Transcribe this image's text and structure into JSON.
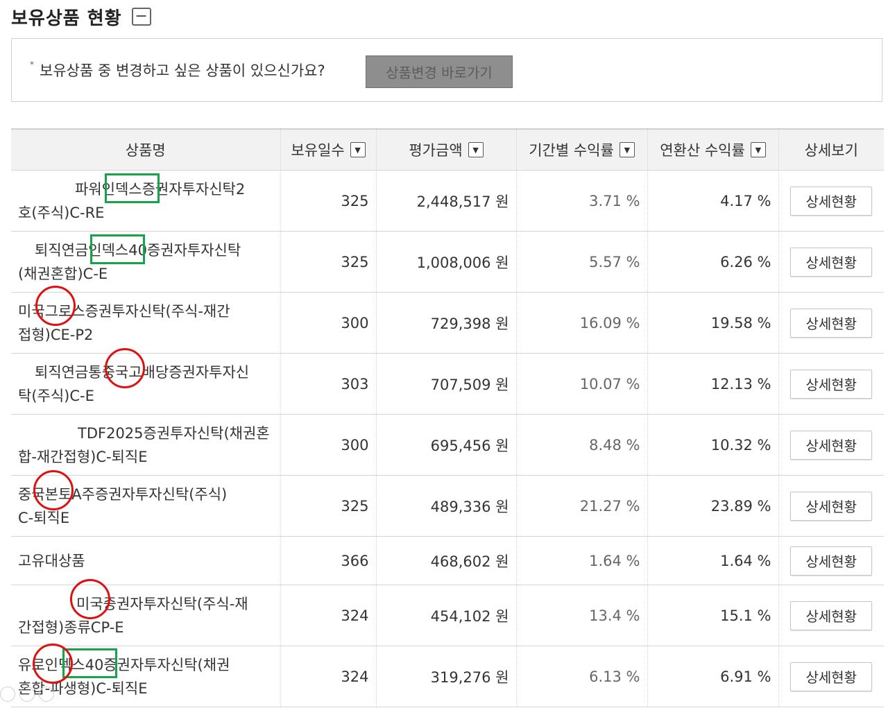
{
  "section": {
    "title": "보유상품 현황",
    "collapse_icon": "−"
  },
  "notice": {
    "bullet": "*",
    "text": "보유상품 중 변경하고 싶은 상품이 있으신가요?",
    "button_label": "상품변경 바로가기"
  },
  "table": {
    "headers": {
      "name": "상품명",
      "days": "보유일수",
      "amount": "평가금액",
      "period_return": "기간별 수익률",
      "annual_return": "연환산 수익률",
      "detail": "상세보기"
    },
    "sort_icon": "▼",
    "rows": [
      {
        "name_line1": "파워인덱스증권자투자신탁2",
        "name_line2": "호(주식)C-RE",
        "days": "325",
        "amount": "2,448,517 원",
        "period_return": "3.71 %",
        "annual_return": "4.17 %",
        "detail": "상세현황"
      },
      {
        "name_line1": "퇴직연금인덱스40증권자투자신탁",
        "name_line2": "(채권혼합)C-E",
        "days": "325",
        "amount": "1,008,006 원",
        "period_return": "5.57 %",
        "annual_return": "6.26 %",
        "detail": "상세현황"
      },
      {
        "name_line1": "미국그로스증권투자신탁(주식-재간",
        "name_line2": "접형)CE-P2",
        "days": "300",
        "amount": "729,398 원",
        "period_return": "16.09 %",
        "annual_return": "19.58 %",
        "detail": "상세현황"
      },
      {
        "name_line1": "퇴직연금통중국고배당증권자투자신",
        "name_line2": "탁(주식)C-E",
        "days": "303",
        "amount": "707,509 원",
        "period_return": "10.07 %",
        "annual_return": "12.13 %",
        "detail": "상세현황"
      },
      {
        "name_line1": "TDF2025증권투자신탁(채권혼",
        "name_line2": "합-재간접형)C-퇴직E",
        "days": "300",
        "amount": "695,456 원",
        "period_return": "8.48 %",
        "annual_return": "10.32 %",
        "detail": "상세현황"
      },
      {
        "name_line1": "중국본토A주증권자투자신탁(주식)",
        "name_line2": "C-퇴직E",
        "days": "325",
        "amount": "489,336 원",
        "period_return": "21.27 %",
        "annual_return": "23.89 %",
        "detail": "상세현황"
      },
      {
        "name_line1": "고유대상품",
        "name_line2": "",
        "days": "366",
        "amount": "468,602 원",
        "period_return": "1.64 %",
        "annual_return": "1.64 %",
        "detail": "상세현황"
      },
      {
        "name_line1": "미국증권자투자신탁(주식-재",
        "name_line2": "간접형)종류CP-E",
        "days": "324",
        "amount": "454,102 원",
        "period_return": "13.4 %",
        "annual_return": "15.1 %",
        "detail": "상세현황"
      },
      {
        "name_line1": "유로인덱스40증권자투자신탁(채권",
        "name_line2": "혼합-파생형)C-퇴직E",
        "days": "324",
        "amount": "319,276 원",
        "period_return": "6.13 %",
        "annual_return": "6.91 %",
        "detail": "상세현황"
      }
    ]
  },
  "annotations": {
    "green_box_color": "#17a34a",
    "red_circle_color": "#e01010"
  }
}
